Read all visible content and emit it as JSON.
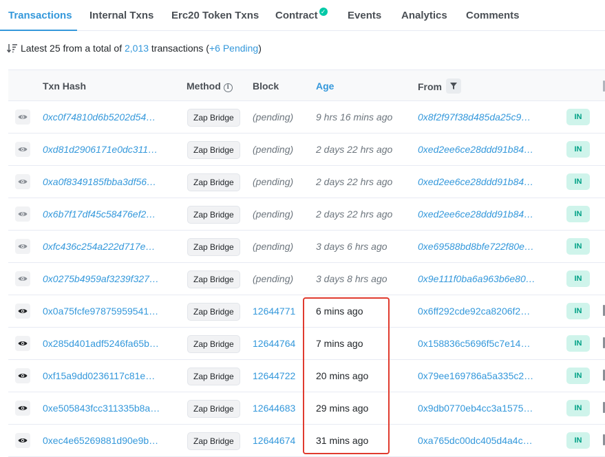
{
  "tabs": [
    {
      "label": "Transactions",
      "active": true
    },
    {
      "label": "Internal Txns"
    },
    {
      "label": "Erc20 Token Txns"
    },
    {
      "label": "Contract",
      "verified_icon": "check-circle-icon"
    },
    {
      "label": "Events"
    },
    {
      "label": "Analytics"
    },
    {
      "label": "Comments"
    }
  ],
  "summary": {
    "prefix": "Latest 25 from a total of ",
    "total": "2,013",
    "middle": " transactions (",
    "pending": "+6 Pending",
    "suffix": ")"
  },
  "table": {
    "columns": {
      "txn_hash": "Txn Hash",
      "method": "Method",
      "block": "Block",
      "age": "Age",
      "from": "From"
    },
    "rows": [
      {
        "hash": "0xc0f74810d6b5202d54…",
        "method": "Zap Bridge",
        "block": "(pending)",
        "age": "9 hrs 16 mins ago",
        "from": "0x8f2f97f38d485da25c9…",
        "direction": "IN",
        "pending": true
      },
      {
        "hash": "0xd81d2906171e0dc311…",
        "method": "Zap Bridge",
        "block": "(pending)",
        "age": "2 days 22 hrs ago",
        "from": "0xed2ee6ce28ddd91b84…",
        "direction": "IN",
        "pending": true
      },
      {
        "hash": "0xa0f8349185fbba3df56…",
        "method": "Zap Bridge",
        "block": "(pending)",
        "age": "2 days 22 hrs ago",
        "from": "0xed2ee6ce28ddd91b84…",
        "direction": "IN",
        "pending": true
      },
      {
        "hash": "0x6b7f17df45c58476ef2…",
        "method": "Zap Bridge",
        "block": "(pending)",
        "age": "2 days 22 hrs ago",
        "from": "0xed2ee6ce28ddd91b84…",
        "direction": "IN",
        "pending": true
      },
      {
        "hash": "0xfc436c254a222d717e…",
        "method": "Zap Bridge",
        "block": "(pending)",
        "age": "3 days 6 hrs ago",
        "from": "0xe69588bd8bfe722f80e…",
        "direction": "IN",
        "pending": true
      },
      {
        "hash": "0x0275b4959af3239f327…",
        "method": "Zap Bridge",
        "block": "(pending)",
        "age": "3 days 8 hrs ago",
        "from": "0x9e111f0ba6a963b6e80…",
        "direction": "IN",
        "pending": true
      },
      {
        "hash": "0x0a75fcfe97875959541…",
        "method": "Zap Bridge",
        "block": "12644771",
        "age": "6 mins ago",
        "from": "0x6ff292cde92ca8206f2…",
        "direction": "IN",
        "pending": false
      },
      {
        "hash": "0x285d401adf5246fa65b…",
        "method": "Zap Bridge",
        "block": "12644764",
        "age": "7 mins ago",
        "from": "0x158836c5696f5c7e14…",
        "direction": "IN",
        "pending": false
      },
      {
        "hash": "0xf15a9dd0236117c81e…",
        "method": "Zap Bridge",
        "block": "12644722",
        "age": "20 mins ago",
        "from": "0x79ee169786a5a335c2…",
        "direction": "IN",
        "pending": false
      },
      {
        "hash": "0xe505843fcc311335b8a…",
        "method": "Zap Bridge",
        "block": "12644683",
        "age": "29 mins ago",
        "from": "0x9db0770eb4cc3a1575…",
        "direction": "IN",
        "pending": false
      },
      {
        "hash": "0xec4e65269881d90e9b…",
        "method": "Zap Bridge",
        "block": "12644674",
        "age": "31 mins ago",
        "from": "0xa765dc00dc405d4a4c…",
        "direction": "IN",
        "pending": false
      }
    ]
  },
  "colors": {
    "accent": "#3498db",
    "in_badge_bg": "#cff4eb",
    "in_badge_text": "#00a186",
    "highlight": "#e03a2e"
  }
}
